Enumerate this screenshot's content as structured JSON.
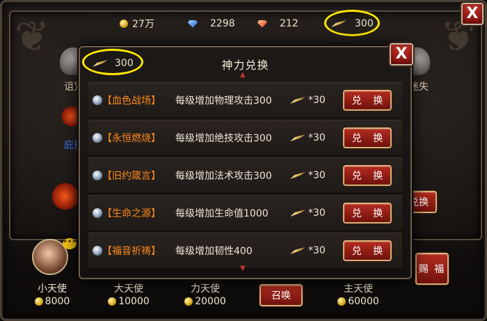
{
  "currency_bar": {
    "gold": "27万",
    "diamonds": "2298",
    "rubies": "212",
    "wings": "300",
    "icons": [
      "coin-icon",
      "blue-diamond-icon",
      "red-gem-icon",
      "wing-icon"
    ]
  },
  "outer_close_label": "X",
  "background": {
    "left_label": "诅咒",
    "right_label": "迷失",
    "left_blue_label": "庇护",
    "right_button_label": "兑换"
  },
  "modal": {
    "title": "神力兑换",
    "wallet_value": "300",
    "close_label": "X",
    "items": [
      {
        "name": "【血色战场】",
        "description": "每级增加物理攻击300",
        "cost": "*30",
        "button": "兑 换"
      },
      {
        "name": "【永恒燃烧】",
        "description": "每级增加绝技攻击300",
        "cost": "*30",
        "button": "兑 换"
      },
      {
        "name": "【旧约箴言】",
        "description": "每级增加法术攻击300",
        "cost": "*30",
        "button": "兑 换"
      },
      {
        "name": "【生命之源】",
        "description": "每级增加生命值1000",
        "cost": "*30",
        "button": "兑 换"
      },
      {
        "name": "【福音祈祷】",
        "description": "每级增加韧性400",
        "cost": "*30",
        "button": "兑 换"
      }
    ]
  },
  "angels": [
    {
      "name": "小天使",
      "cost": "8000"
    },
    {
      "name": "大天使",
      "cost": "10000"
    },
    {
      "name": "力天使",
      "cost": "20000"
    },
    {
      "name": "主天使",
      "cost": "60000"
    }
  ],
  "summon_button": "召唤",
  "bless_button": "赐 福",
  "chat_bubble": "•••",
  "colors": {
    "highlight": "#ffe800",
    "item_name": "#ff8a1a",
    "button_red": "#b42c20"
  }
}
